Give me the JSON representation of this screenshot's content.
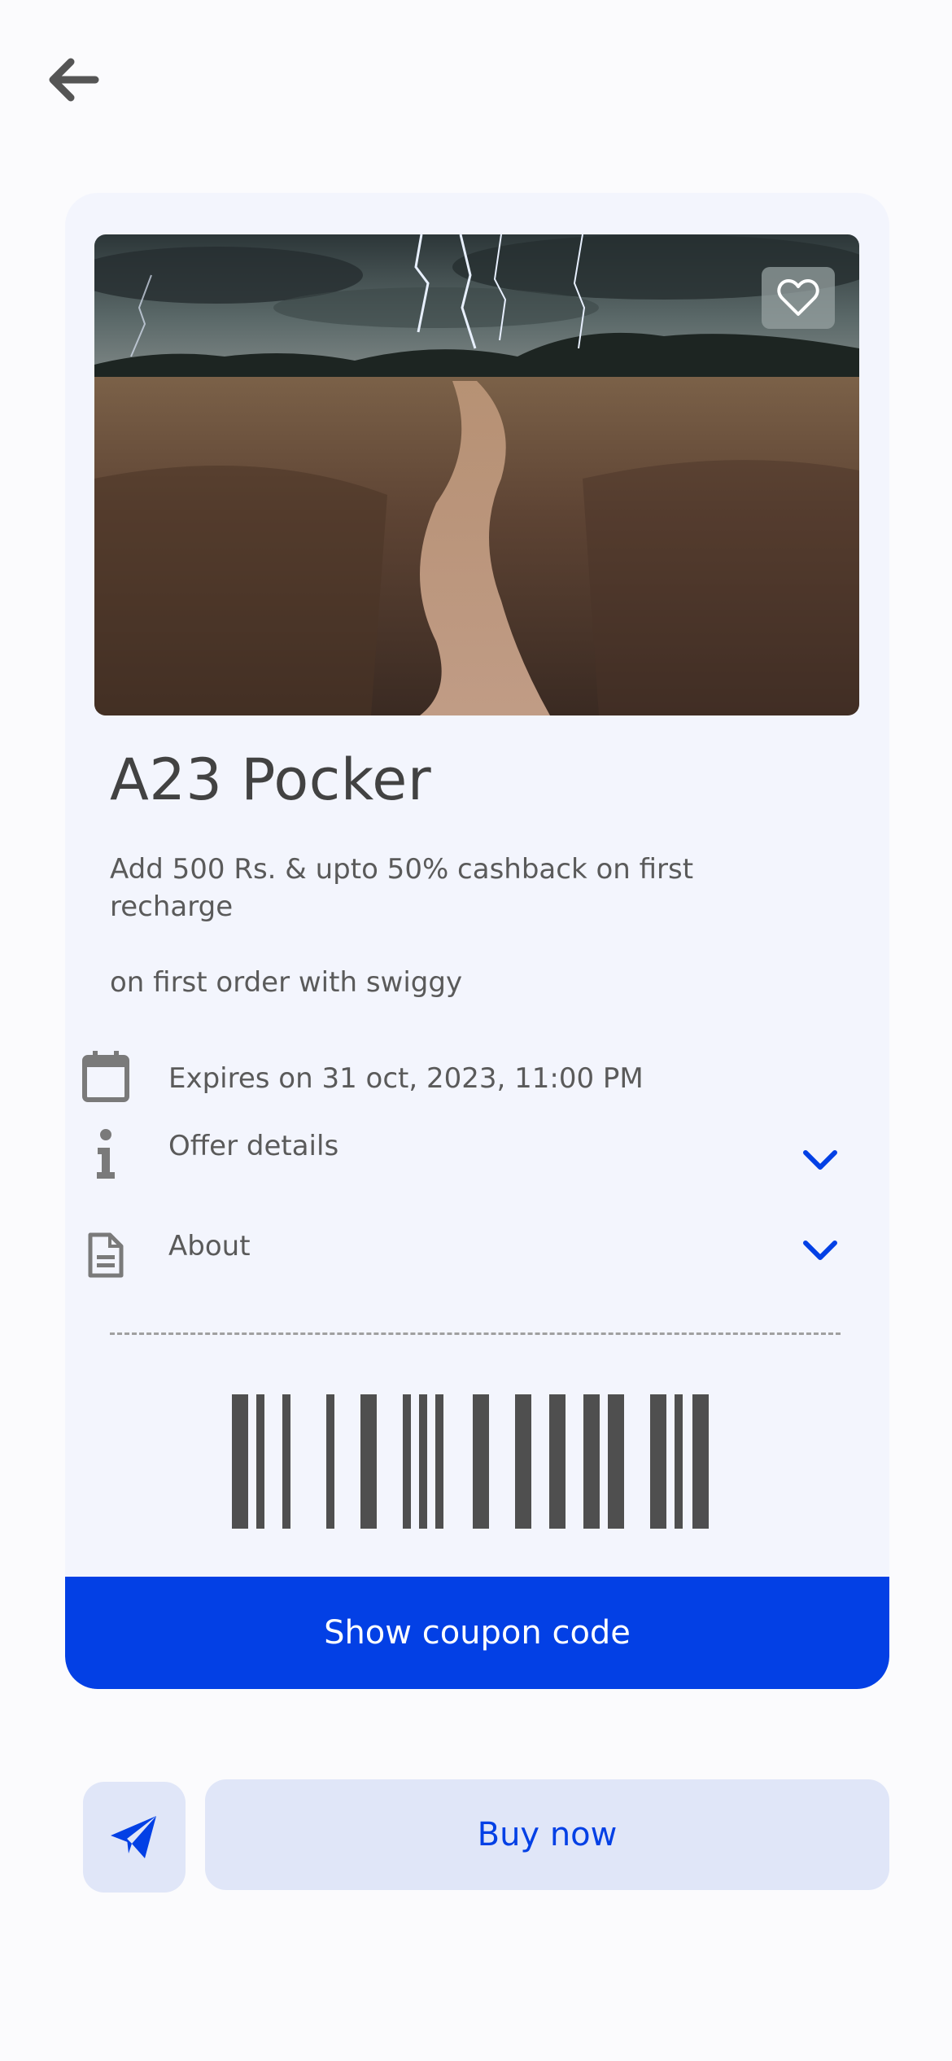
{
  "header": {
    "back_icon": "arrow-left-icon"
  },
  "offer": {
    "image_alt": "Field path under stormy lightning sky",
    "favorite_icon": "heart-icon",
    "title": "A23 Pocker",
    "description": "Add 500 Rs. & upto 50% cashback on first recharge",
    "subdescription": "on first order with swiggy",
    "expiry_label": "Expires on 31 oct, 2023, 11:00 PM",
    "offer_details_label": "Offer details",
    "about_label": "About",
    "coupon_button_label": "Show coupon code"
  },
  "actions": {
    "share_icon": "paper-plane-icon",
    "buy_label": "Buy now"
  },
  "colors": {
    "accent": "#0340e5",
    "card_bg": "#f3f5fd",
    "secondary_btn_bg": "#e0e6f8",
    "text": "#454545",
    "icon_gray": "#7a7a7a"
  }
}
